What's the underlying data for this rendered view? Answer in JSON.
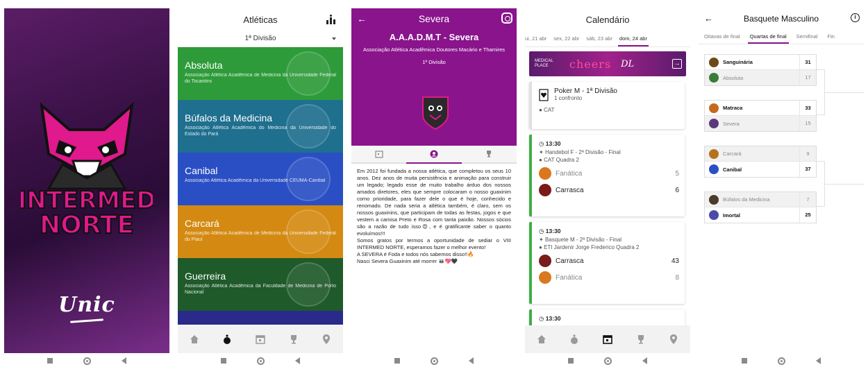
{
  "splash": {
    "logo_text_line1": "INTERMED",
    "logo_text_line2": "NORTE",
    "brand": "Unic"
  },
  "atleticas": {
    "title": "Atléticas",
    "division": "1ª Divisão",
    "clubs": [
      {
        "name": "Absoluta",
        "desc": "Associação Atlética Acadêmica de Medicina da Universidade Federal do Tocantins",
        "color": "#2e9b3a"
      },
      {
        "name": "Búfalos da Medicina",
        "desc": "Associação Atlética Acadêmica do Medicina da Universidade do Estado do Pará",
        "color": "#1f6f8f"
      },
      {
        "name": "Canibal",
        "desc": "Associação Atlética Acadêmica da Universidade CEUMA-Canibal",
        "color": "#2a4fc4"
      },
      {
        "name": "Carcará",
        "desc": "Associação Atlética Acadêmica de Medicina da Universidade Federal do Piauí",
        "color": "#d48a12"
      },
      {
        "name": "Guerreira",
        "desc": "Associação Atlética Acadêmica da Faculdade de Medicina de Porto Nacional",
        "color": "#1f5a2a"
      }
    ]
  },
  "severa": {
    "title": "Severa",
    "name": "A.A.A.D.M.T - Severa",
    "fullname": "Associação Atlética Acadêmica Doutores Macário e Thamires",
    "division": "1ª Divisão",
    "body": [
      "Em 2012 foi fundada a nossa atlética, que completou os seus 10 anos. Dez anos de muita persistência e animação para construir um legado; legado esse de muito trabalho árduo dos nossos amados diretores, eles que sempre colocaram o nosso guaxinim como prioridade, para fazer dele o que é hoje, conhecido e renomado. De nada seria a atlética também, é claro, sem os nossos guaxinins, que participam de todas as festas, jogos e que vestem a camisa Preto e Rosa com tanta paixão. Nossos sócios são a razão de tudo isso😍, e é gratificante saber o quanto evoluímos!!!",
      "Somos gratos por termos a oportunidade de sediar o VIII INTERMED NORTE, esperamos fazer o melhor evento!",
      "A SEVERA é Foda e todos nós sabemos disso!!🔥",
      "Nasci Severa Guaxinim até morrer 🦝💖🖤"
    ]
  },
  "calendario": {
    "title": "Calendário",
    "days": [
      "ui, 21 abr",
      "sex, 22 abr",
      "sáb, 23 abr",
      "dom, 24 abr"
    ],
    "selected_day": "dom, 24 abr",
    "banner": {
      "left": "MEDICAL PLACE",
      "mid": "cheers",
      "right": "DL"
    },
    "events": [
      {
        "title": "Poker M - 1ª Divisão",
        "sub": "1 confronto",
        "place": "CAT"
      },
      {
        "time": "13:30",
        "title": "Handebol F - 2ª Divisão - Final",
        "place": "CAT Quadra 2",
        "teams": [
          {
            "name": "Fanática",
            "score": "5"
          },
          {
            "name": "Carrasca",
            "score": "6"
          }
        ]
      },
      {
        "time": "13:30",
        "title": "Basquete M - 2ª Divisão - Final",
        "place": "ETI Jardenir Jorge Frederico Quadra 2",
        "teams": [
          {
            "name": "Carrasca",
            "score": "43"
          },
          {
            "name": "Fanática",
            "score": "8"
          }
        ]
      },
      {
        "time": "13:30"
      }
    ]
  },
  "bracket": {
    "title": "Basquete Masculino",
    "phases": [
      "Oitavas de final",
      "Quartas de final",
      "Semifinal",
      "Fin"
    ],
    "selected_phase": "Quartas de final",
    "matches": [
      [
        {
          "name": "Sanguinária",
          "score": "31",
          "win": true
        },
        {
          "name": "Absoluta",
          "score": "17",
          "win": false
        }
      ],
      [
        {
          "name": "Matraca",
          "score": "33",
          "win": true
        },
        {
          "name": "Severa",
          "score": "15",
          "win": false
        }
      ],
      [
        {
          "name": "Carcará",
          "score": "9",
          "win": false
        },
        {
          "name": "Canibal",
          "score": "37",
          "win": true
        }
      ],
      [
        {
          "name": "Búfalos da Medicina",
          "score": "7",
          "win": false
        },
        {
          "name": "Imortal",
          "score": "25",
          "win": true
        }
      ]
    ]
  },
  "colors": {
    "brand_purple": "#8a148c",
    "accent_pink": "#e0198c",
    "event_green": "#3fae45"
  }
}
